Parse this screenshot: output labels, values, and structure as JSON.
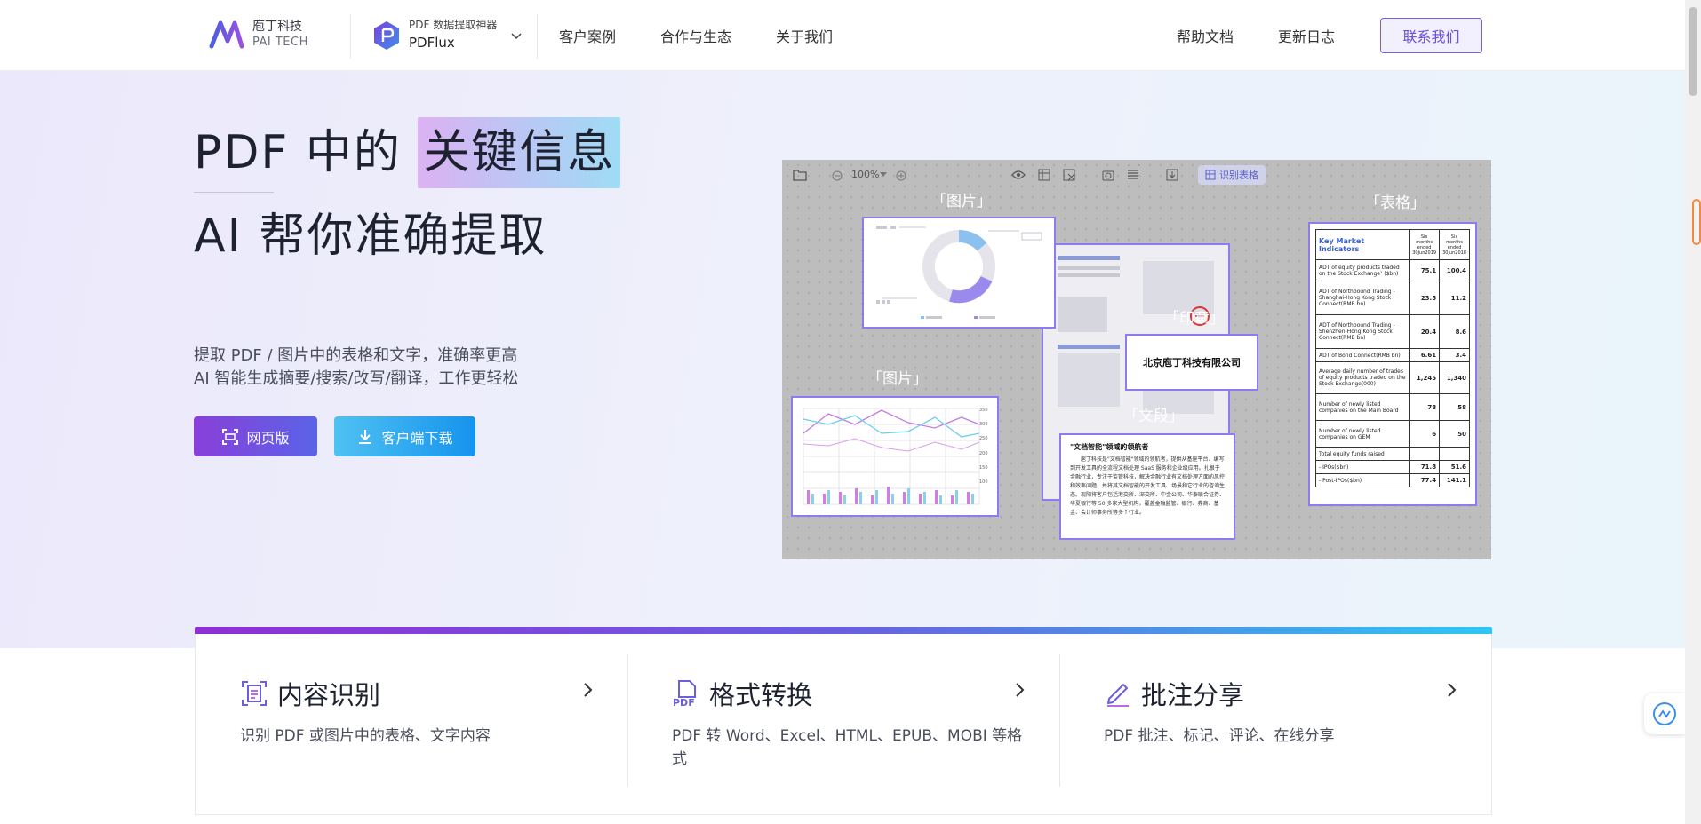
{
  "header": {
    "logo_cn": "庖丁科技",
    "logo_en": "PAI TECH",
    "product_sub": "PDF 数据提取神器",
    "product_name": "PDFlux",
    "nav": [
      "客户案例",
      "合作与生态",
      "关于我们"
    ],
    "right_links": [
      "帮助文档",
      "更新日志"
    ],
    "contact_label": "联系我们"
  },
  "hero": {
    "title_prefix": "PDF 中的",
    "title_highlight": "关键信息",
    "title2": "AI 帮你准确提取",
    "desc_line1": "提取 PDF / 图片中的表格和文字，准确率更高",
    "desc_line2": "AI 智能生成摘要/搜索/改写/翻译，工作更轻松",
    "btn_web": "网页版",
    "btn_download": "客户端下载"
  },
  "preview": {
    "zoom": "100%",
    "recognize_label": "识别表格",
    "label_image_top": "「图片」",
    "label_image_left": "「图片」",
    "label_table": "「表格」",
    "label_seal": "「印章」",
    "label_paragraph": "「文段」",
    "company": "北京庖丁科技有限公司",
    "paragraph_title": "\"文档智能\"领域的领航者",
    "paragraph_body": "庖丁科技是\"文档智能\"领域的领航者，提供从基座平台、编写到开发工具的全流程文档处理 SaaS 服务和企业级应用。扎根于金融行业，专注于监管科技，解决金融行业有文档处理方面的风控和效率问题，并将其文档智能的开发工具、场景和它行业的咨询生态。现阳将客户包括港交所、深交所、中金公司、华泰联合证券、华夏银行等 50 多家大型机构，覆盖金融监管、银行、券商、基金、会计师事务所等多个行业。",
    "chart_ticks": [
      "350",
      "300",
      "250",
      "200",
      "150",
      "100"
    ],
    "table": {
      "title": "Key Market Indicators",
      "col1": "Six months ended 30Jun2019",
      "col2": "Six months ended 30Jun2018",
      "rows": [
        {
          "label": "ADT of equity products traded on the Stock Exchange¹ ($bn)",
          "v1": "75.1",
          "v2": "100.4"
        },
        {
          "label": "ADT of Northbound Trading - Shanghai-Hong Kong Stock Connect(RMB bn)",
          "v1": "23.5",
          "v2": "11.2"
        },
        {
          "label": "ADT of Northbound Trading - Shenzhen-Hong Kong Stock Connect(RMB bn)",
          "v1": "20.4",
          "v2": "8.6"
        },
        {
          "label": "ADT of Bond Connect(RMB bn)",
          "v1": "6.61",
          "v2": "3.4"
        },
        {
          "label": "Average daily number of trades of equity products traded on the Stock Exchange(000)",
          "v1": "1,245",
          "v2": "1,340"
        },
        {
          "label": "Number of newly listed companies on the Main Board",
          "v1": "78",
          "v2": "58"
        },
        {
          "label": "Number of newly listed companies on GEM",
          "v1": "6",
          "v2": "50"
        },
        {
          "label": "Total equity funds raised",
          "v1": "",
          "v2": ""
        },
        {
          "label": "- IPOs($bn)",
          "v1": "71.8",
          "v2": "51.6"
        },
        {
          "label": "- Post-IPOs($bn)",
          "v1": "77.4",
          "v2": "141.1"
        }
      ]
    }
  },
  "features": [
    {
      "title": "内容识别",
      "desc": "识别 PDF 或图片中的表格、文字内容"
    },
    {
      "title": "格式转换",
      "desc": "PDF 转 Word、Excel、HTML、EPUB、MOBI 等格式"
    },
    {
      "title": "批注分享",
      "desc": "PDF 批注、标记、评论、在线分享"
    }
  ],
  "colors": {
    "accent": "#6a4fd8",
    "brand_purple": "#8a3fd9",
    "brand_blue": "#1593ee"
  }
}
